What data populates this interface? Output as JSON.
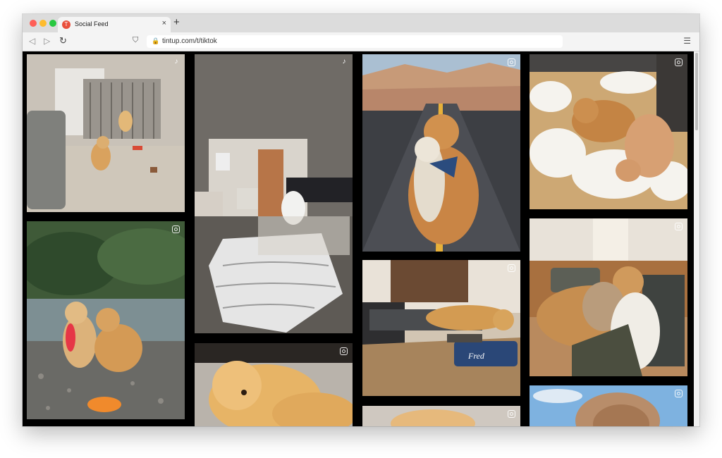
{
  "browser": {
    "tab_title": "Social Feed",
    "tab_favicon": "T",
    "tab_close_icon": "×",
    "new_tab_icon": "+",
    "url": "tintup.com/t/tiktok",
    "back_icon": "◁",
    "forward_icon": "▷",
    "reload_icon": "↻",
    "bookmark_icon": "⛉",
    "menu_icon": "☰"
  },
  "feed": {
    "tiles": [
      {
        "source": "tiktok-icon",
        "scene": "golden retriever puppy in living room with playpen"
      },
      {
        "source": "tiktok-icon",
        "scene": "white puppy and blanket on floor"
      },
      {
        "source": "instagram-icon",
        "scene": "golden retriever holding plush toy on desert road"
      },
      {
        "source": "instagram-icon",
        "scene": "golden retriever with torn plush bear and stuffing"
      },
      {
        "source": "instagram-icon",
        "scene": "two golden retrievers at lake with frisbee"
      },
      {
        "source": "instagram-icon",
        "scene": "golden retriever puppy lying on floor"
      },
      {
        "source": "instagram-icon",
        "scene": "golden retriever on cot with name bowl"
      },
      {
        "source": "instagram-icon",
        "scene": "golden retriever sleeping with teddy on sofa"
      },
      {
        "source": "instagram-icon",
        "scene": "golden retriever close-up"
      },
      {
        "source": "instagram-icon",
        "scene": "puppy fur against blue sky"
      }
    ]
  },
  "bowl_text": "Fred",
  "colors": {
    "tab_favicon": "#e94f3c",
    "viewport": "#000000",
    "golden": "#d9a25e"
  }
}
